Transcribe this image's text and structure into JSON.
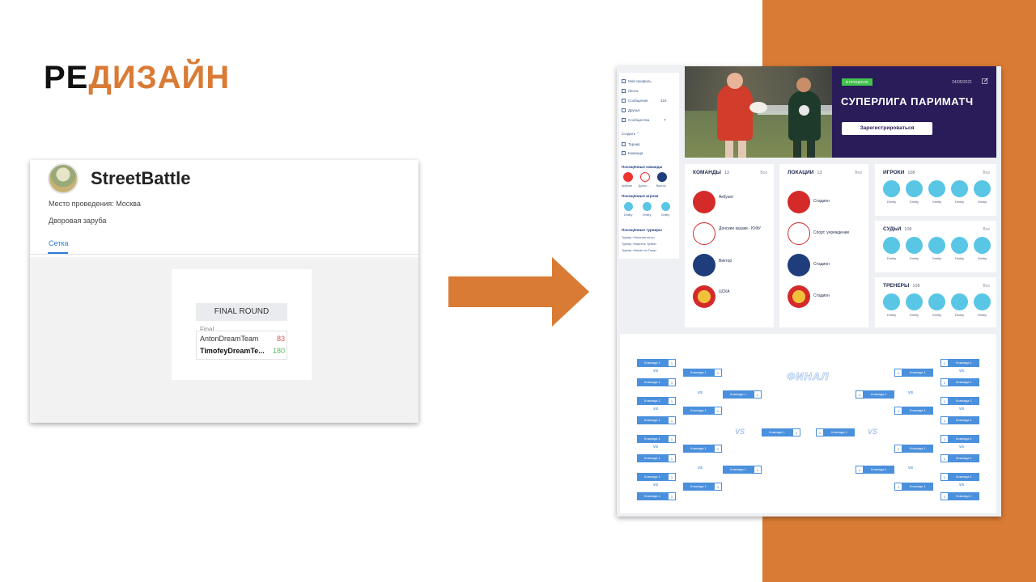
{
  "slide": {
    "title_part1": "РЕ",
    "title_part2": "ДИЗАЙН",
    "accent_color": "#d97b35"
  },
  "old_ui": {
    "name": "StreetBattle",
    "place": "Место проведения: Москва",
    "description": "Дворовая заруба",
    "tab": "Сетка",
    "round_title": "FINAL ROUND",
    "match_label": "Final",
    "team1": {
      "name": "AntonDreamTeam",
      "score": "83"
    },
    "team2": {
      "name": "TimofeyDreamTe...",
      "score": "180"
    }
  },
  "new_ui": {
    "sidebar": {
      "items": [
        {
          "label": "Мой профиль",
          "count": ""
        },
        {
          "label": "Лента",
          "count": ""
        },
        {
          "label": "Сообщения",
          "count": "415"
        },
        {
          "label": "Друзья",
          "count": ""
        },
        {
          "label": "Сообщества",
          "count": "7"
        }
      ],
      "create": "Создать",
      "create_items": [
        "Турнир",
        "Команда"
      ],
      "visited_teams_title": "Посещённые команды",
      "visited_teams": [
        "Акбузат",
        "Донск...",
        "Виктор"
      ],
      "visited_players_title": "Посещённые игроки",
      "visited_players": [
        "Dmitry",
        "Dmitry",
        "Dmitry"
      ],
      "visited_tournaments_title": "Посещённые турниры",
      "visited_tournaments": [
        "Турнир «Золотая пять»",
        "Турнир «Картель Трэба»",
        "Турнир «Канал на Танц»"
      ]
    },
    "banner": {
      "status": "В ПРОЦЕССЕ",
      "date": "24/05/2021",
      "title": "СУПЕРЛИГА ПАРИМАТЧ",
      "button": "Зарегистрироваться"
    },
    "teams": {
      "title": "КОМАНДЫ",
      "count": "13",
      "all": "Все",
      "items": [
        "Акбузат",
        "Донские казаки - ЮФУ",
        "Виктор",
        "ЦСКА"
      ]
    },
    "locations": {
      "title": "ЛОКАЦИИ",
      "count": "13",
      "all": "Все",
      "items": [
        "Стадион",
        "Спорт. учреждение",
        "Стадион",
        "Стадион"
      ]
    },
    "players": {
      "title": "ИГРОКИ",
      "count": "108",
      "all": "Все",
      "names": [
        "Dmitry",
        "Dmitry",
        "Dmitry",
        "Dmitry",
        "Dmitry"
      ]
    },
    "judges": {
      "title": "СУДЬИ",
      "count": "108",
      "all": "Все",
      "names": [
        "Dmitry",
        "Dmitry",
        "Dmitry",
        "Dmitry",
        "Dmitry"
      ]
    },
    "coaches": {
      "title": "ТРЕНЕРЫ",
      "count": "108",
      "all": "Все",
      "names": [
        "Dmitry",
        "Dmitry",
        "Dmitry",
        "Dmitry",
        "Dmitry"
      ]
    },
    "bracket": {
      "final_label": "ФИНАЛ",
      "team_name": "Команда 1",
      "team_score": "1",
      "vs": "VS"
    }
  }
}
